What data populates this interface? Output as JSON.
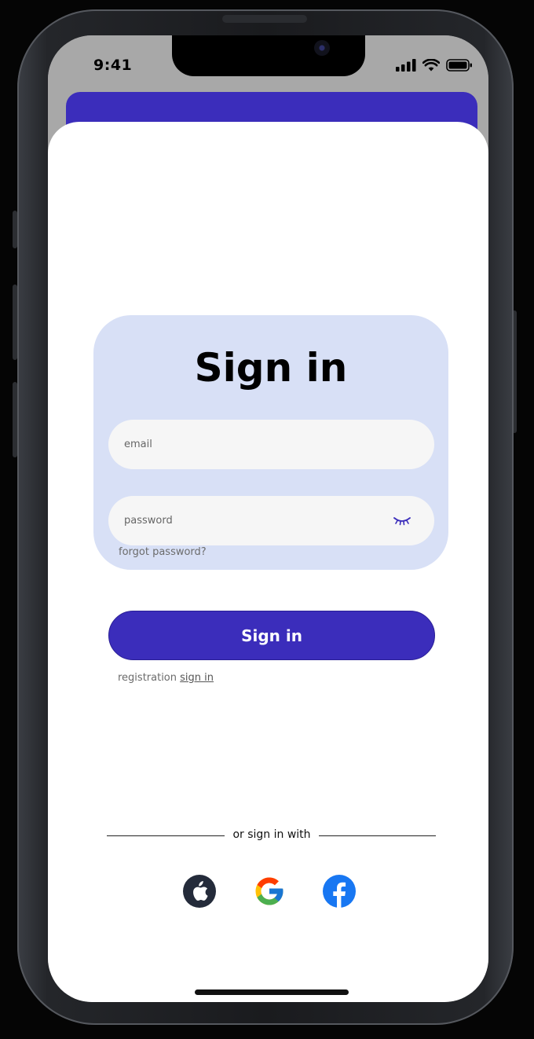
{
  "status_bar": {
    "time": "9:41"
  },
  "login": {
    "title": "Sign in",
    "email_placeholder": "email",
    "password_placeholder": "password",
    "forgot_password": "forgot password?",
    "submit_label": "Sign in",
    "registration_text": "registration",
    "registration_link": "sign in",
    "alt_signin_text": "or sign in with"
  },
  "social_providers": [
    {
      "name": "apple",
      "icon": "apple-icon"
    },
    {
      "name": "google",
      "icon": "google-icon"
    },
    {
      "name": "facebook",
      "icon": "facebook-icon"
    }
  ],
  "colors": {
    "accent": "#3b2dbb",
    "card_background": "#d8e0f6",
    "field_background": "#f6f6f6",
    "facebook_blue": "#1877f2",
    "apple_background": "#242b3a"
  }
}
